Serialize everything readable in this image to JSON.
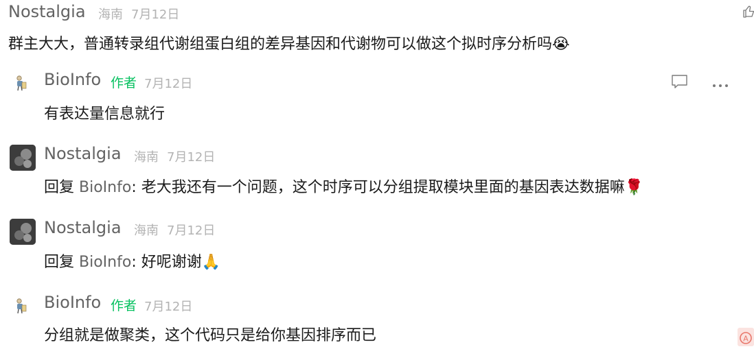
{
  "comments": [
    {
      "author": "Nostalgia",
      "location": "海南",
      "date": "7月12日",
      "text": "群主大大，普通转录组代谢组蛋白组的差异基因和代谢物可以做这个拟时序分析吗",
      "emoji": "😭"
    }
  ],
  "replies": [
    {
      "author": "BioInfo",
      "author_tag": "作者",
      "date": "7月12日",
      "text": "有表达量信息就行"
    },
    {
      "author": "Nostalgia",
      "location": "海南",
      "date": "7月12日",
      "reply_prefix": "回复",
      "reply_to": "BioInfo",
      "text": "老大我还有一个问题，这个时序可以分组提取模块里面的基因表达数据嘛",
      "emoji": "🌹"
    },
    {
      "author": "Nostalgia",
      "location": "海南",
      "date": "7月12日",
      "reply_prefix": "回复",
      "reply_to": "BioInfo",
      "text": "好呢谢谢",
      "emoji": "🙏"
    },
    {
      "author": "BioInfo",
      "author_tag": "作者",
      "date": "7月12日",
      "text": "分组就是做聚类，这个代码只是给你基因排序而已"
    }
  ],
  "icons": {
    "like": "thumbs-up-icon",
    "comment": "comment-bubble-icon",
    "more": "more-ellipsis-icon",
    "corner": "app-badge-icon"
  },
  "colors": {
    "author_tag": "#07c160",
    "name": "#636363",
    "meta": "#b3b3b3",
    "text": "#1a1a1a"
  }
}
